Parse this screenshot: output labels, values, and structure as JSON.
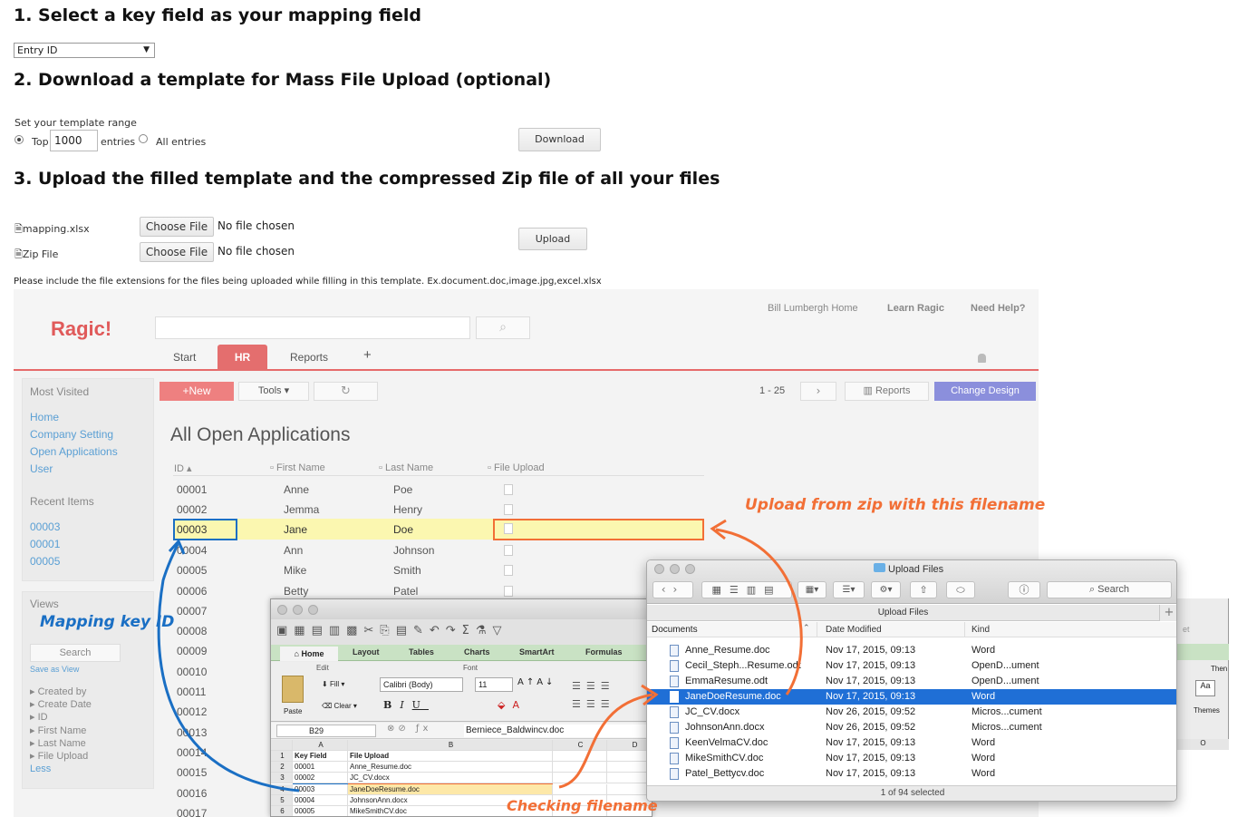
{
  "step1": {
    "heading": "1. Select a key field as your mapping field",
    "select_value": "Entry ID"
  },
  "step2": {
    "heading": "2. Download a template for Mass File Upload (optional)",
    "range_label": "Set your template range",
    "top_label": "Top",
    "top_value": "1000",
    "entries_label": "entries",
    "all_entries_label": "All entries",
    "download_label": "Download"
  },
  "step3": {
    "heading": "3. Upload the filled template and the compressed Zip file of all your files",
    "mapping_label": "mapping.xlsx",
    "zip_label": "Zip File",
    "choose_label": "Choose File",
    "no_file": "No file chosen",
    "upload_label": "Upload",
    "note": "Please include the file extensions for the files being uploaded while filling in this template. Ex.document.doc,image.jpg,excel.xlsx"
  },
  "ragic": {
    "logo": "Ragic!",
    "nav_user": "Bill Lumbergh Home",
    "nav_learn": "Learn Ragic",
    "nav_help": "Need Help?",
    "tabs": [
      "Start",
      "HR",
      "Reports",
      "+"
    ],
    "most_visited_title": "Most Visited",
    "most_visited": [
      "Home",
      "Company Setting",
      "Open Applications",
      "User"
    ],
    "recent_title": "Recent Items",
    "recent": [
      "00003",
      "00001",
      "00005"
    ],
    "views_title": "Views",
    "search_label": "Search",
    "save_as_view": "Save as View",
    "view_fields": [
      "Created by",
      "Create Date",
      "ID",
      "First Name",
      "Last Name",
      "File Upload"
    ],
    "less": "Less",
    "new_label": "+New",
    "tools_label": "Tools",
    "pager": "1 - 25",
    "reports_btn": "Reports",
    "change_design": "Change Design",
    "page_title": "All Open Applications",
    "columns": [
      "ID",
      "First Name",
      "Last Name",
      "File Upload"
    ],
    "rows": [
      {
        "id": "00001",
        "first": "Anne",
        "last": "Poe"
      },
      {
        "id": "00002",
        "first": "Jemma",
        "last": "Henry"
      },
      {
        "id": "00003",
        "first": "Jane",
        "last": "Doe"
      },
      {
        "id": "00004",
        "first": "Ann",
        "last": "Johnson"
      },
      {
        "id": "00005",
        "first": "Mike",
        "last": "Smith"
      },
      {
        "id": "00006",
        "first": "Betty",
        "last": "Patel"
      },
      {
        "id": "00007",
        "first": "",
        "last": ""
      },
      {
        "id": "00008",
        "first": "",
        "last": ""
      },
      {
        "id": "00009",
        "first": "",
        "last": ""
      },
      {
        "id": "00010",
        "first": "",
        "last": ""
      },
      {
        "id": "00011",
        "first": "",
        "last": ""
      },
      {
        "id": "00012",
        "first": "",
        "last": ""
      },
      {
        "id": "00013",
        "first": "",
        "last": ""
      },
      {
        "id": "00014",
        "first": "",
        "last": ""
      },
      {
        "id": "00015",
        "first": "",
        "last": ""
      },
      {
        "id": "00016",
        "first": "",
        "last": ""
      },
      {
        "id": "00017",
        "first": "",
        "last": ""
      }
    ]
  },
  "excel": {
    "tabs": [
      "Home",
      "Layout",
      "Tables",
      "Charts",
      "SmartArt",
      "Formulas"
    ],
    "group_edit": "Edit",
    "group_font": "Font",
    "fill": "Fill",
    "clear": "Clear",
    "paste": "Paste",
    "font_name": "Calibri (Body)",
    "font_size": "11",
    "cell_ref": "B29",
    "formula_value": "Berniece_Baldwincv.doc",
    "col_headers": [
      "A",
      "B",
      "C",
      "D"
    ],
    "rows": [
      {
        "n": "1",
        "a": "Key Field",
        "b": "File Upload"
      },
      {
        "n": "2",
        "a": "00001",
        "b": "Anne_Resume.doc"
      },
      {
        "n": "3",
        "a": "00002",
        "b": "JC_CV.docx"
      },
      {
        "n": "4",
        "a": "00003",
        "b": "JaneDoeResume.doc"
      },
      {
        "n": "5",
        "a": "00004",
        "b": "JohnsonAnn.docx"
      },
      {
        "n": "6",
        "a": "00005",
        "b": "MikeSmithCV.doc"
      }
    ],
    "right_partial_then": "Then",
    "right_partial_themes": "Themes",
    "right_partial_col": "O"
  },
  "finder": {
    "title": "Upload Files",
    "search": "Search",
    "path": "Upload Files",
    "col_name": "Documents",
    "col_date": "Date Modified",
    "col_kind": "Kind",
    "files": [
      {
        "name": "Anne_Resume.doc",
        "date": "Nov 17, 2015, 09:13",
        "kind": "Word"
      },
      {
        "name": "Cecil_Steph...Resume.odt",
        "date": "Nov 17, 2015, 09:13",
        "kind": "OpenD...ument"
      },
      {
        "name": "EmmaResume.odt",
        "date": "Nov 17, 2015, 09:13",
        "kind": "OpenD...ument"
      },
      {
        "name": "JaneDoeResume.doc",
        "date": "Nov 17, 2015, 09:13",
        "kind": "Word"
      },
      {
        "name": "JC_CV.docx",
        "date": "Nov 26, 2015, 09:52",
        "kind": "Micros...cument"
      },
      {
        "name": "JohnsonAnn.docx",
        "date": "Nov 26, 2015, 09:52",
        "kind": "Micros...cument"
      },
      {
        "name": "KeenVelmaCV.doc",
        "date": "Nov 17, 2015, 09:13",
        "kind": "Word"
      },
      {
        "name": "MikeSmithCV.doc",
        "date": "Nov 17, 2015, 09:13",
        "kind": "Word"
      },
      {
        "name": "Patel_Bettycv.doc",
        "date": "Nov 17, 2015, 09:13",
        "kind": "Word"
      }
    ],
    "status": "1 of 94 selected",
    "partial_set": "et"
  },
  "annotations": {
    "mapping_key": "Mapping key ID",
    "upload_from_zip": "Upload from zip with this filename",
    "checking": "Checking filename",
    "blue": "#1a6fc4",
    "orange": "#f26f36"
  }
}
